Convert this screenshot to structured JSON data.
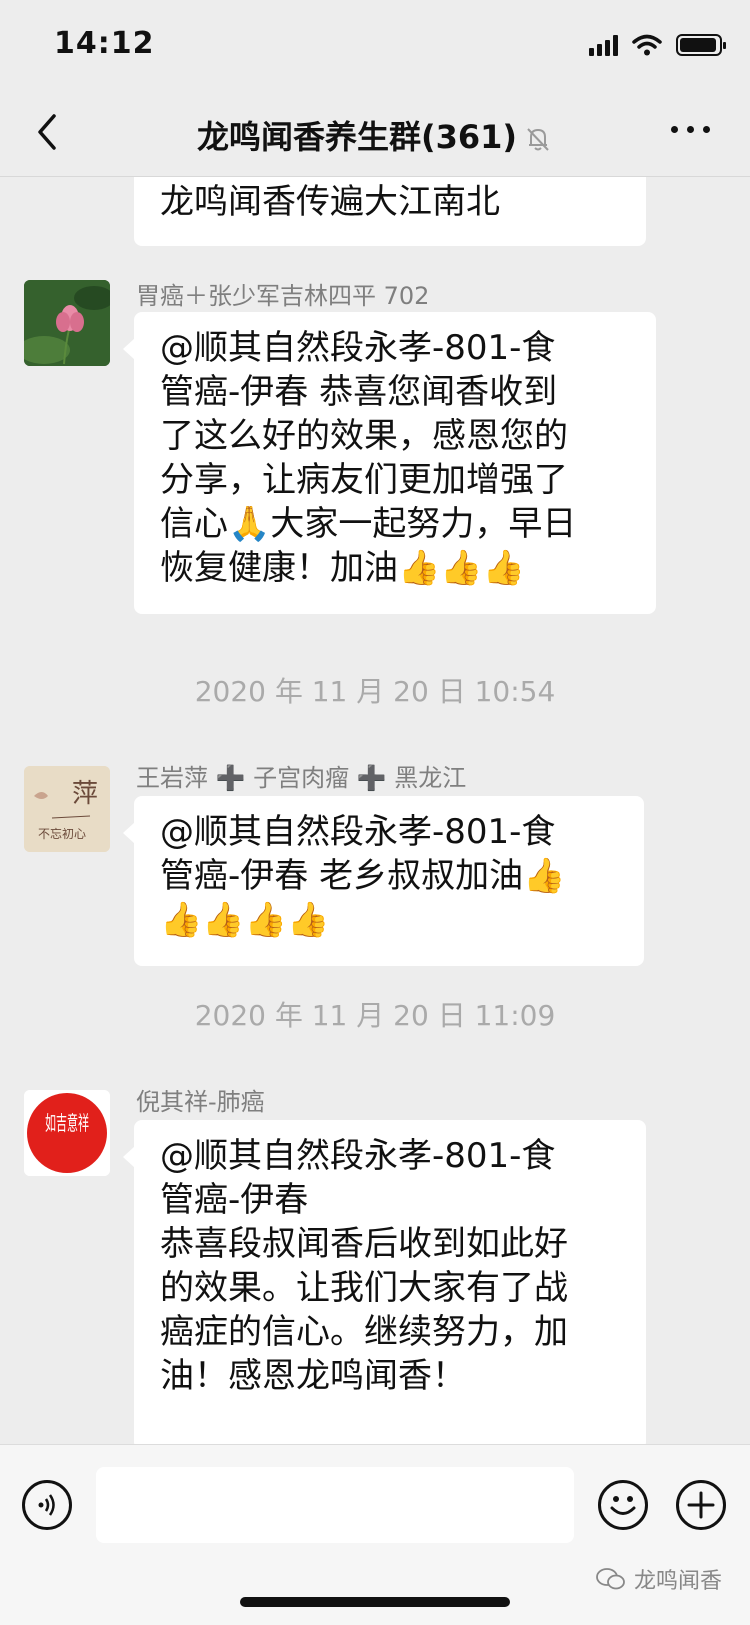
{
  "status_bar": {
    "time": "14:12"
  },
  "nav": {
    "title": "龙鸣闻香养生群(361)"
  },
  "messages": [
    {
      "text": "我们一起迎向健康的同时将\n龙鸣闻香传遍大江南北"
    },
    {
      "sender": "胃癌＋张少军吉林四平 702",
      "text": "@顺其自然段永孝-801-食\n管癌-伊春 恭喜您闻香收到\n了这么好的效果，感恩您的\n分享，让病友们更加增强了\n信心🙏大家一起努力，早日\n恢复健康！加油👍👍👍"
    },
    {
      "timestamp": "2020 年 11 月 20 日 10:54"
    },
    {
      "sender": "王岩萍 ➕ 子宫肉瘤 ➕ 黑龙江",
      "text": "@顺其自然段永孝-801-食\n管癌-伊春 老乡叔叔加油👍\n👍👍👍👍"
    },
    {
      "timestamp": "2020 年 11 月 20 日 11:09"
    },
    {
      "sender": "倪其祥-肺癌",
      "text": "@顺其自然段永孝-801-食\n管癌-伊春\n恭喜段叔闻香后收到如此好\n的效果。让我们大家有了战\n癌症的信心。继续努力，加\n油！感恩龙鸣闻香！"
    }
  ],
  "avatars": {
    "avatar2_text": "萍",
    "avatar2_sub": "不忘初心",
    "avatar3_text": "如吉意祥"
  },
  "watermark": "龙鸣闻香",
  "colors": {
    "background": "#ededed",
    "bubble": "#ffffff",
    "meta_text": "#7f7f7f"
  }
}
